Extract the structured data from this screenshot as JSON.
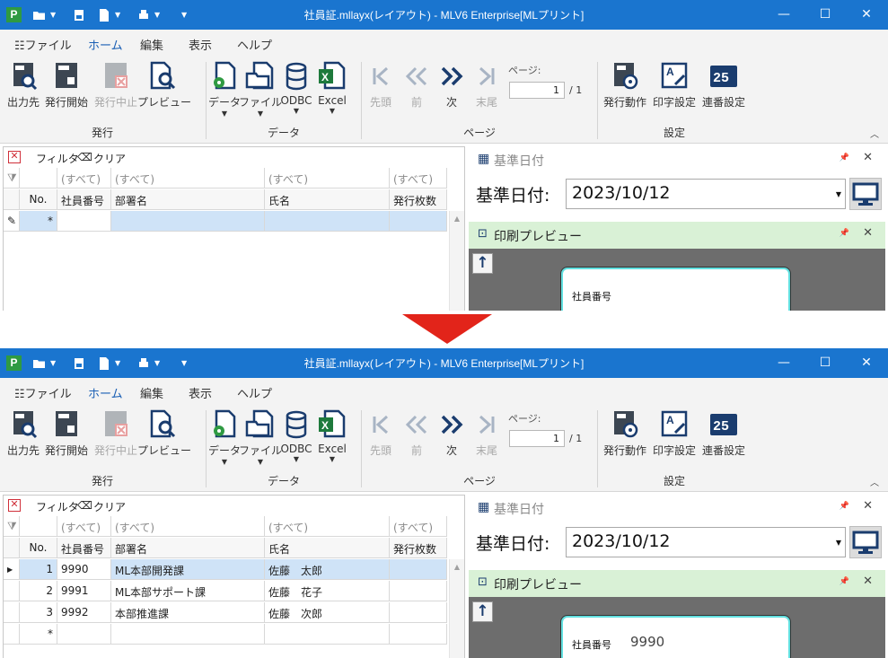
{
  "app": {
    "icon_letter": "P",
    "title": "社員証.mllayx(レイアウト) - MLV6 Enterprise[MLプリント]",
    "window_controls": [
      "—",
      "☐",
      "✕"
    ]
  },
  "colors": {
    "titlebar": "#1a75cf",
    "accent": "#1a75cf",
    "arrow": "#e2241a",
    "preview_header": "#d9f1d6"
  },
  "menu": {
    "file": "ファイル",
    "home": "ホーム",
    "edit": "編集",
    "view": "表示",
    "help": "ヘルプ"
  },
  "ribbon": {
    "issue_group": {
      "label": "発行",
      "output": "出力先",
      "start": "発行開始",
      "stop": "発行中止",
      "preview": "プレビュー"
    },
    "data_group": {
      "label": "データ",
      "data": "データ",
      "file": "ファイル",
      "odbc": "ODBC",
      "excel": "Excel"
    },
    "page_group": {
      "label": "ページ",
      "first": "先頭",
      "prev": "前",
      "next": "次",
      "last": "末尾",
      "page_label": "ページ:",
      "page_value": "1",
      "page_total": "/ 1"
    },
    "settings_group": {
      "label": "設定",
      "operation": "発行動作",
      "print": "印字設定",
      "serial": "連番設定"
    }
  },
  "filterbar": {
    "filter": "フィルタ",
    "clear": "クリア"
  },
  "grid": {
    "filter_all": "(すべて)",
    "columns": {
      "no": "No.",
      "emp_no": "社員番号",
      "dept": "部署名",
      "name": "氏名",
      "count": "発行枚数"
    },
    "new_row_marker": "*",
    "rows": [
      {
        "no": "1",
        "emp_no": "9990",
        "dept": "ML本部開発課",
        "name": "佐藤　太郎",
        "count": ""
      },
      {
        "no": "2",
        "emp_no": "9991",
        "dept": "ML本部サポート課",
        "name": "佐藤　花子",
        "count": ""
      },
      {
        "no": "3",
        "emp_no": "9992",
        "dept": "本部推進課",
        "name": "佐藤　次郎",
        "count": ""
      }
    ]
  },
  "kijun": {
    "panel_title": "基準日付",
    "label": "基準日付:",
    "date": "2023/10/12"
  },
  "preview": {
    "panel_title": "印刷プレビュー",
    "field_label": "社員番号",
    "field_value": "9990"
  }
}
